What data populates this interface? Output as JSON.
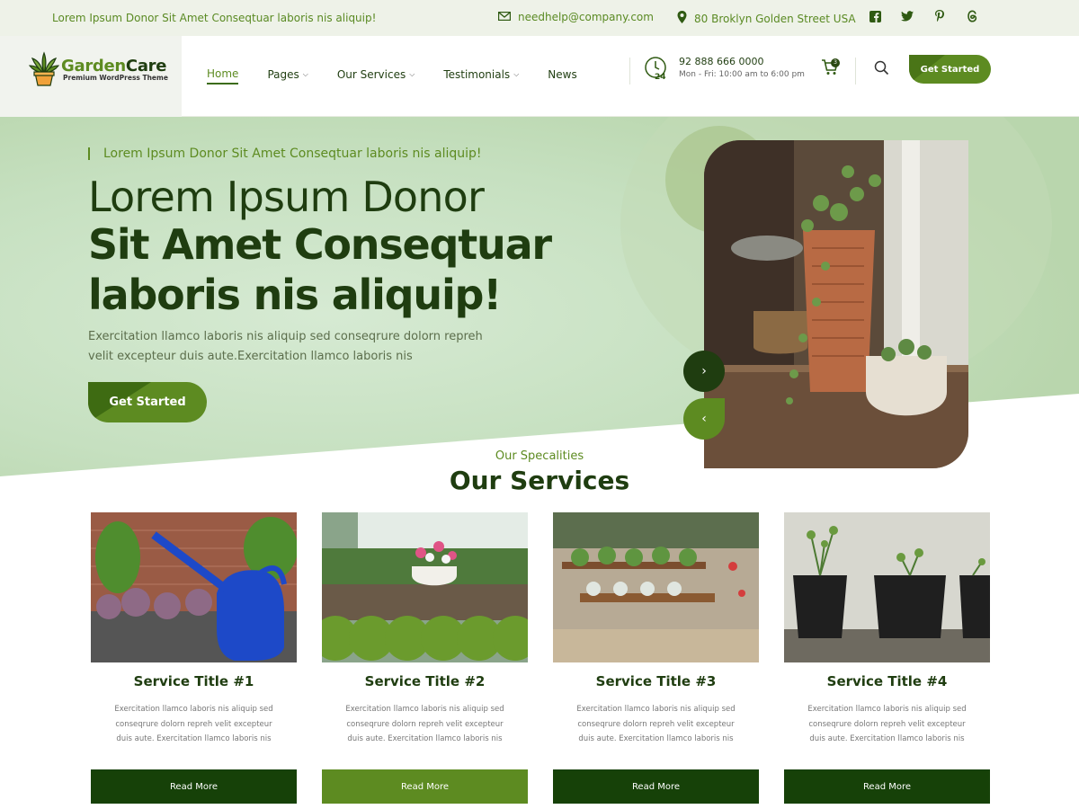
{
  "topbar": {
    "tagline": "Lorem Ipsum Donor Sit Amet Conseqtuar laboris nis aliquip!",
    "email": "needhelp@company.com",
    "address": "80 Broklyn Golden Street USA",
    "socials": [
      "facebook-icon",
      "twitter-icon",
      "pinterest-icon",
      "threads-icon"
    ]
  },
  "header": {
    "logo_main_a": "Garden",
    "logo_main_b": "Care",
    "logo_sub": "Premium WordPress Theme",
    "nav": [
      {
        "label": "Home",
        "active": true
      },
      {
        "label": "Pages",
        "dropdown": true
      },
      {
        "label": "Our Services",
        "dropdown": true
      },
      {
        "label": "Testimonials",
        "dropdown": true
      },
      {
        "label": "News"
      }
    ],
    "phone": "92 888 666 0000",
    "hours": "Mon - Fri: 10:00 am to 6:00 pm",
    "cart_count": "3",
    "cta": "Get Started"
  },
  "hero": {
    "tag": "Lorem Ipsum Donor Sit Amet Conseqtuar laboris nis aliquip!",
    "line1": "Lorem Ipsum Donor",
    "line2": "Sit Amet Conseqtuar laboris nis aliquip!",
    "desc": "Exercitation llamco laboris nis aliquip sed conseqrure dolorn repreh velit excepteur duis aute.Exercitation llamco laboris nis",
    "cta": "Get Started",
    "next_glyph": "›",
    "prev_glyph": "‹"
  },
  "services": {
    "label": "Our Specalities",
    "title": "Our Services",
    "cards": [
      {
        "title": "Service Title #1",
        "text": "Exercitation llamco laboris nis aliquip sed conseqrure dolorn repreh velit excepteur duis aute. Exercitation llamco laboris nis",
        "button": "Read More"
      },
      {
        "title": "Service Title #2",
        "text": "Exercitation llamco laboris nis aliquip sed conseqrure dolorn repreh velit excepteur duis aute. Exercitation llamco laboris nis",
        "button": "Read More"
      },
      {
        "title": "Service Title #3",
        "text": "Exercitation llamco laboris nis aliquip sed conseqrure dolorn repreh velit excepteur duis aute. Exercitation llamco laboris nis",
        "button": "Read More"
      },
      {
        "title": "Service Title #4",
        "text": "Exercitation llamco laboris nis aliquip sed conseqrure dolorn repreh velit excepteur duis aute. Exercitation llamco laboris nis",
        "button": "Read More"
      }
    ]
  },
  "colors": {
    "brand_green": "#5d8b21",
    "dark_green": "#1f3d10",
    "button_dark": "#164108"
  }
}
